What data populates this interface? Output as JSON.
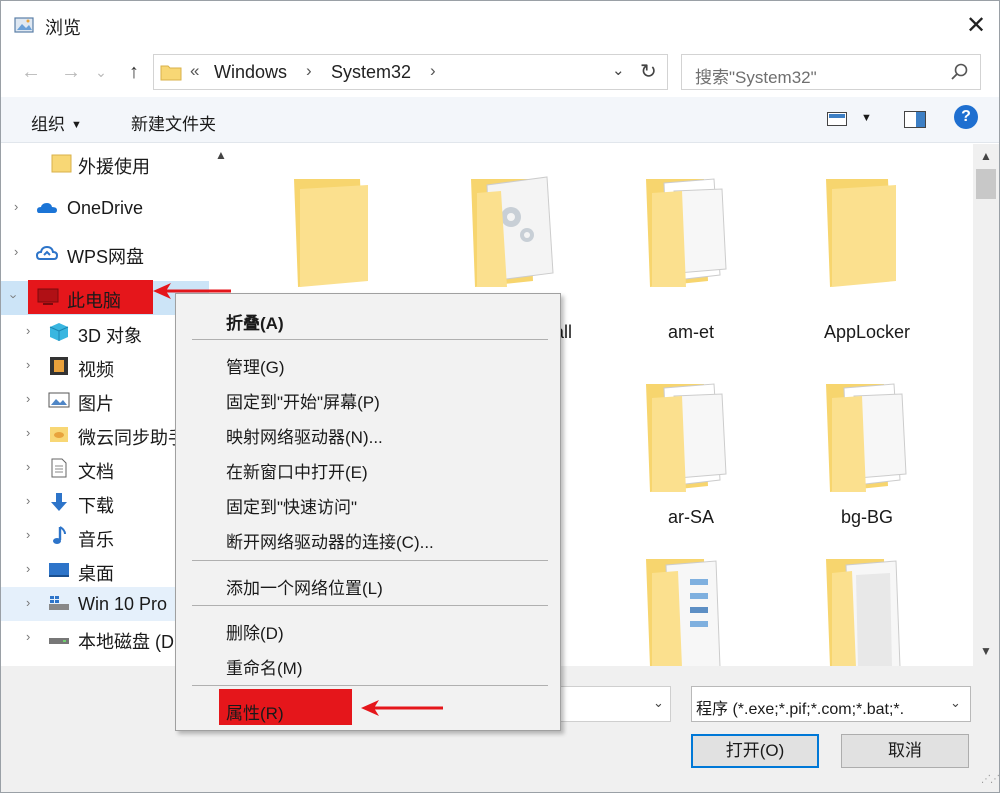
{
  "window": {
    "title": "浏览",
    "close_glyph": "✕"
  },
  "nav": {
    "back": "←",
    "forward": "→",
    "recent": "⌄",
    "up": "↑"
  },
  "address": {
    "overflow": "«",
    "crumbs": [
      "Windows",
      "System32"
    ],
    "sep": "›",
    "drop": "⌄",
    "refresh": "↻"
  },
  "search": {
    "placeholder": "搜索\"System32\""
  },
  "toolbar": {
    "organize": "组织",
    "new_folder": "新建文件夹",
    "help": "?"
  },
  "sidebar": {
    "items": [
      {
        "label": "外援使用",
        "icon": "folder-icon"
      },
      {
        "label": "OneDrive",
        "icon": "onedrive-icon"
      },
      {
        "label": "WPS网盘",
        "icon": "cloud-icon"
      },
      {
        "label": "此电脑",
        "icon": "computer-icon"
      },
      {
        "label": "3D 对象",
        "icon": "cube-icon"
      },
      {
        "label": "视频",
        "icon": "video-icon"
      },
      {
        "label": "图片",
        "icon": "picture-icon"
      },
      {
        "label": "微云同步助手",
        "icon": "weiyun-icon"
      },
      {
        "label": "文档",
        "icon": "document-icon"
      },
      {
        "label": "下载",
        "icon": "download-icon"
      },
      {
        "label": "音乐",
        "icon": "music-icon"
      },
      {
        "label": "桌面",
        "icon": "desktop-icon"
      },
      {
        "label": "Win 10 Pro",
        "icon": "drive-icon"
      },
      {
        "label": "本地磁盘 (D",
        "icon": "disk-icon"
      }
    ]
  },
  "files": [
    {
      "label": "",
      "kind": "folder"
    },
    {
      "label": "tall",
      "kind": "folder-gear"
    },
    {
      "label": "am-et",
      "kind": "folder-docs"
    },
    {
      "label": "AppLocker",
      "kind": "folder"
    },
    {
      "label": "ar-SA",
      "kind": "folder-docs"
    },
    {
      "label": "bg-BG",
      "kind": "folder-docs"
    }
  ],
  "context_menu": {
    "items": [
      {
        "label": "折叠(A)",
        "bold": true
      },
      {
        "label": "管理(G)"
      },
      {
        "label": "固定到\"开始\"屏幕(P)"
      },
      {
        "label": "映射网络驱动器(N)..."
      },
      {
        "label": "在新窗口中打开(E)"
      },
      {
        "label": "固定到\"快速访问\""
      },
      {
        "label": "断开网络驱动器的连接(C)..."
      },
      {
        "label": "添加一个网络位置(L)"
      },
      {
        "label": "删除(D)"
      },
      {
        "label": "重命名(M)"
      },
      {
        "label": "属性(R)"
      }
    ]
  },
  "footer": {
    "filter": "程序 (*.exe;*.pif;*.com;*.bat;*.",
    "open": "打开(O)",
    "cancel": "取消"
  },
  "colors": {
    "annotation_red": "#e5161b",
    "accent_blue": "#0078d7",
    "folder_yellow": "#f8d775"
  }
}
